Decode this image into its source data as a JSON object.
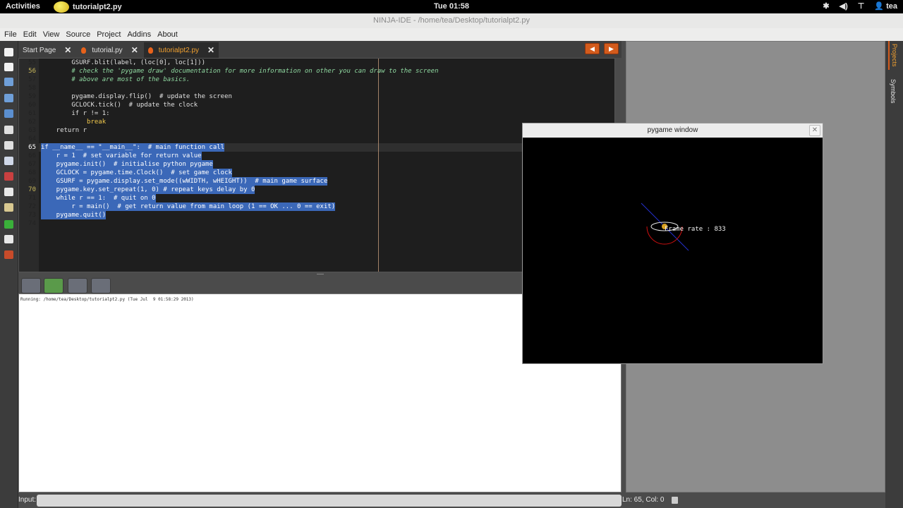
{
  "topbar": {
    "activities": "Activities",
    "app_name": "tutorialpt2.py",
    "clock": "Tue 01:58",
    "user": "tea"
  },
  "window": {
    "title": "NINJA-IDE - /home/tea/Desktop/tutorialpt2.py"
  },
  "menu": {
    "items": [
      "File",
      "Edit",
      "View",
      "Source",
      "Project",
      "Addins",
      "About"
    ]
  },
  "tabs": [
    {
      "label": "Start Page",
      "active": false
    },
    {
      "label": "tutorial.py",
      "active": false
    },
    {
      "label": "tutorialpt2.py",
      "active": true
    }
  ],
  "editor": {
    "lines": [
      {
        "n": "55",
        "text": "        GSURF.blit(label, (loc[0], loc[1]))"
      },
      {
        "n": "56",
        "text": "        # check the 'pygame draw' documentation for more information on other you can draw to the screen"
      },
      {
        "n": "57",
        "text": "        # above are most of the basics."
      },
      {
        "n": "58",
        "text": ""
      },
      {
        "n": "59",
        "text": "        pygame.display.flip()  # update the screen"
      },
      {
        "n": "60",
        "text": "        GCLOCK.tick()  # update the clock"
      },
      {
        "n": "61",
        "text": "        if r != 1:"
      },
      {
        "n": "62",
        "text": "            break"
      },
      {
        "n": "63",
        "text": "    return r"
      },
      {
        "n": "64",
        "text": ""
      },
      {
        "n": "65",
        "text": "if __name__ == \"__main__\":  # main function call"
      },
      {
        "n": "66",
        "text": "    r = 1  # set variable for return value"
      },
      {
        "n": "67",
        "text": "    pygame.init()  # initialise python pygame"
      },
      {
        "n": "68",
        "text": "    GCLOCK = pygame.time.Clock()  # set game clock"
      },
      {
        "n": "69",
        "text": "    GSURF = pygame.display.set_mode((wWIDTH, wHEIGHT))  # main game surface"
      },
      {
        "n": "70",
        "text": "    pygame.key.set_repeat(1, 0) # repeat keys delay by 0"
      },
      {
        "n": "71",
        "text": "    while r == 1:  # quit on 0"
      },
      {
        "n": "72",
        "text": "        r = main()  # get return value from main loop (1 == OK ... 0 == exit)"
      },
      {
        "n": "73",
        "text": "    pygame.quit()"
      },
      {
        "n": "74",
        "text": ""
      }
    ]
  },
  "console": {
    "output": "Running: /home/tea/Desktop/tutorialpt2.py (Tue Jul  9 01:58:29 2013)"
  },
  "input": {
    "label": "Input:"
  },
  "status": {
    "text": "Ln: 65, Col: 0"
  },
  "side_tabs": [
    "Projects",
    "Symbols"
  ],
  "pygame": {
    "title": "pygame window",
    "fps_text": "Frame rate : 833"
  },
  "colors": {
    "accent": "#d35b1c",
    "selection": "#3b68b8"
  }
}
